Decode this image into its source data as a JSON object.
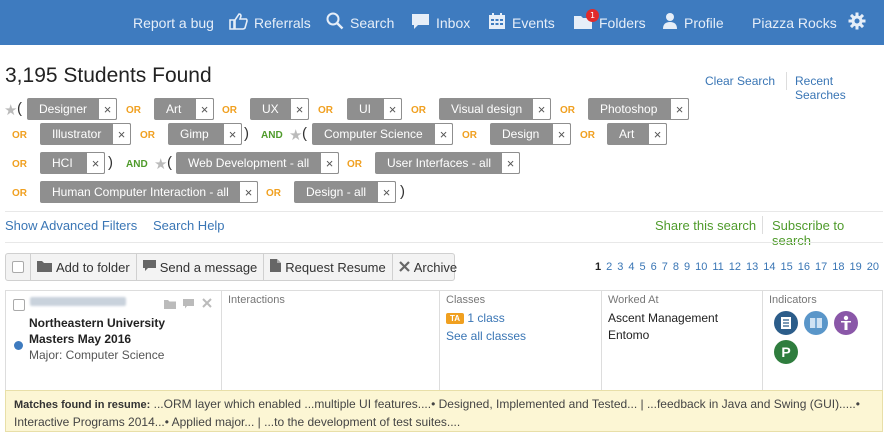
{
  "nav": {
    "report_bug": "Report a bug",
    "referrals": "Referrals",
    "search": "Search",
    "inbox": "Inbox",
    "events": "Events",
    "folders": "Folders",
    "folders_badge": "1",
    "profile": "Profile",
    "piazza_rocks": "Piazza Rocks"
  },
  "colors": {
    "nav_bg": "#3e7bbf",
    "chip_bg": "#8f8f8f",
    "or": "#f0a020",
    "and": "#4f9b2b",
    "link": "#3a76b5"
  },
  "results_title": "3,195 Students Found",
  "header_links": {
    "clear": "Clear Search",
    "recent": "Recent Searches"
  },
  "filters": {
    "row1": [
      "Designer",
      "Art",
      "UX",
      "UI",
      "Visual design",
      "Photoshop"
    ],
    "row2a": [
      "Illustrator",
      "Gimp"
    ],
    "row2b": [
      "Computer Science",
      "Design",
      "Art"
    ],
    "row3a": [
      "HCI"
    ],
    "row3b": [
      "Web Development - all",
      "User Interfaces - all"
    ],
    "row4": [
      "Human Computer Interaction - all",
      "Design - all"
    ],
    "or": "OR",
    "and": "AND",
    "remove": "×"
  },
  "links": {
    "advanced": "Show Advanced Filters",
    "help": "Search Help",
    "share": "Share this search",
    "subscribe": "Subscribe to search"
  },
  "actions": {
    "add_folder": "Add to folder",
    "send_message": "Send a message",
    "request_resume": "Request Resume",
    "archive": "Archive"
  },
  "pages": [
    "1",
    "2",
    "3",
    "4",
    "5",
    "6",
    "7",
    "8",
    "9",
    "10",
    "11",
    "12",
    "13",
    "14",
    "15",
    "16",
    "17",
    "18",
    "19",
    "20"
  ],
  "result": {
    "school": "Northeastern University",
    "degree": "Masters May 2016",
    "major": "Major: Computer Science",
    "interactions_header": "Interactions",
    "classes_header": "Classes",
    "ta_badge": "TA",
    "class_count": "1 class",
    "see_all_classes": "See all classes",
    "worked_header": "Worked At",
    "worked": [
      "Ascent Management",
      "Entomo"
    ],
    "indicators_header": "Indicators",
    "indicator_letter": "P"
  },
  "matches": {
    "label": "Matches found in resume:",
    "text": " ...ORM layer which enabled ...multiple UI features....• Designed, Implemented and Tested... | ...feedback in Java and Swing (GUI).....• Interactive Programs 2014...• Applied major... | ...to the development of test suites...."
  }
}
